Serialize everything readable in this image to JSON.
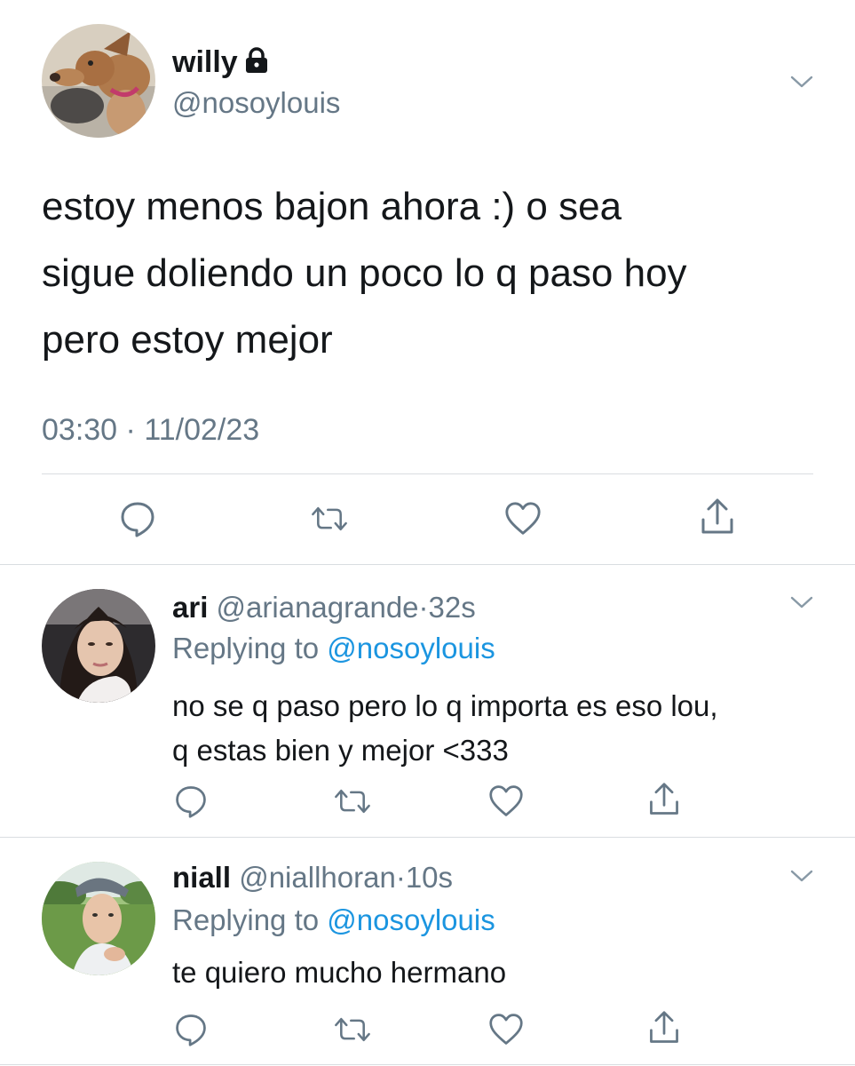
{
  "main_tweet": {
    "display_name": "willy",
    "handle": "@nosoylouis",
    "text_lines": [
      "estoy menos bajon ahora :) o sea",
      "sigue doliendo un poco lo q paso hoy",
      "pero estoy mejor"
    ],
    "time": "03:30",
    "separator": "·",
    "date": "11/02/23",
    "avatar_icon": "dog-avatar",
    "locked_icon": "lock-icon"
  },
  "replies": [
    {
      "display_name": "ari",
      "handle": "@arianagrande",
      "dot": "·",
      "time": "32s",
      "replying_prefix": "Replying to",
      "replying_handle": "@nosoylouis",
      "text_lines": [
        "no se q paso pero lo q importa es eso lou,",
        "q estas bien y mejor <333"
      ]
    },
    {
      "display_name": "niall",
      "handle": "@niallhoran",
      "dot": "·",
      "time": "10s",
      "replying_prefix": "Replying to",
      "replying_handle": "@nosoylouis",
      "text_lines": [
        "te quiero mucho hermano"
      ]
    }
  ],
  "colors": {
    "text": "#14171a",
    "muted": "#657786",
    "link": "#1b95e0",
    "divider": "#d9dde1"
  }
}
